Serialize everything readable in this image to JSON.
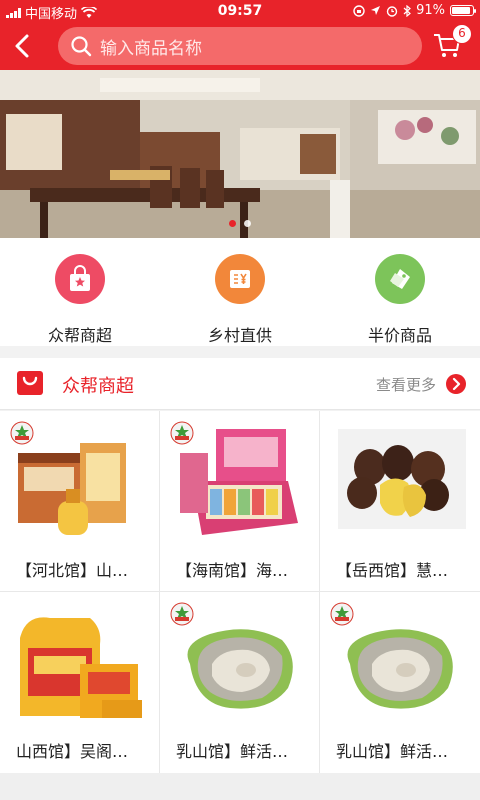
{
  "status_bar": {
    "carrier": "中国移动",
    "time": "09:57",
    "battery": "91%",
    "battery_level": 0.91
  },
  "header": {
    "search_placeholder": "输入商品名称",
    "cart_count": "6",
    "accent": "#e8232a"
  },
  "banner": {
    "slides": 2,
    "active": 1
  },
  "quick_nav": [
    {
      "label": "众帮商超",
      "icon": "shopping-bag-star-icon",
      "color": "#ee4b64"
    },
    {
      "label": "乡村直供",
      "icon": "yuan-voucher-icon",
      "color": "#f2873a"
    },
    {
      "label": "半价商品",
      "icon": "price-tag-icon",
      "color": "#7dc45a"
    }
  ],
  "section": {
    "title": "众帮商超",
    "more": "查看更多"
  },
  "products": [
    {
      "name": "【河北馆】山…"
    },
    {
      "name": "【海南馆】海…"
    },
    {
      "name": "【岳西馆】慧…"
    },
    {
      "name": "山西馆】吴阁…"
    },
    {
      "name": "乳山馆】鲜活…"
    },
    {
      "name": "乳山馆】鲜活…"
    }
  ]
}
